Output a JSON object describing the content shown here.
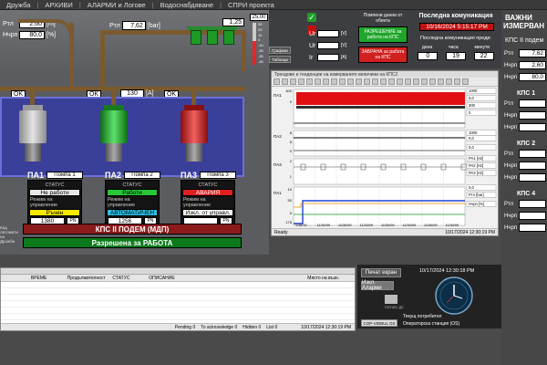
{
  "menu": [
    "Дружба",
    "АРХИВИ",
    "АЛАРМИ и Логове",
    "Водоснабдяване",
    "СПРИ проекта"
  ],
  "process": {
    "top_left": {
      "rtl_label": "Ртл",
      "rtl_value": "2,60",
      "rtl_unit": "[m]",
      "nchr_label": "Нчрп",
      "nchr_value": "80,0",
      "nchr_unit": "[%]"
    },
    "pressure": {
      "label": "Ртл",
      "value": "7,62",
      "unit": "[bar]"
    },
    "tank_value": "1,25",
    "thermo": {
      "value": "25,00",
      "ticks": [
        "30",
        "20",
        "10",
        "0",
        "-10",
        "-20",
        "-30",
        "-40"
      ]
    },
    "buttons": [
      "Графики",
      "Таблици"
    ],
    "ok_labels": [
      "OK",
      "OK",
      "OK"
    ],
    "flow_value": "130",
    "flow_unit": "[A]",
    "pumps": [
      {
        "id": "ПА1",
        "name": "Помпа 1",
        "status_lbl": "СТАТУС",
        "status": "Не работи",
        "mode_lbl": "Режим на управление",
        "mode": "Ръчен",
        "freq": "1380",
        "freq_unit": "PN",
        "color": "#cfcfcf"
      },
      {
        "id": "ПА2",
        "name": "Помпа 2",
        "status_lbl": "СТАТУС",
        "status": "Работи",
        "mode_lbl": "Режим на управление",
        "mode": "АВТОМАТИЧЕН",
        "freq": "1256",
        "freq_unit": "PN",
        "color": "#1fae2a"
      },
      {
        "id": "ПА3",
        "name": "Помпа 3",
        "status_lbl": "СТАТУС",
        "status": "АВАРИЯ",
        "mode_lbl": "Режим на управление",
        "mode": "Изкл. от управл.",
        "freq": "",
        "freq_unit": "PN",
        "color": "#d11c1c"
      }
    ],
    "banner1": "КПС II ПОДЕМ (МДП)",
    "banner2": "Разрешена за РАБОТА",
    "side_note": [
      "Кад",
      "Автомати",
      "на",
      "Дрожби"
    ]
  },
  "controls": {
    "ur_label": "Ur",
    "ur_unit": "[V]",
    "ir_label": "Ir",
    "ir_unit": "[A]",
    "live_data_title": "Помпени данни от обекта",
    "perm_btn": "РАЗРЕШЕНИЕ за работа на КПС",
    "ban_btn": "ЗАБРАНА за работа на КПС"
  },
  "comm": {
    "title": "Последна комуникация",
    "last": "10/16/2024 5:15:17 PM",
    "since_title": "Последна комуникация преди:",
    "days_lbl": "дена",
    "hours_lbl": "часа",
    "min_lbl": "минути",
    "days": "0",
    "hours": "19",
    "minutes": "22"
  },
  "right_panel": {
    "title1": "ВАЖНИ",
    "title2": "ИЗМЕРВАН",
    "sub": "КПС II подем",
    "rows_top": [
      {
        "lbl": "Ртл",
        "val": "7,62"
      },
      {
        "lbl": "Нчрп",
        "val": "2,60"
      },
      {
        "lbl": "Нчрп",
        "val": "80,0"
      }
    ],
    "groups": [
      {
        "title": "КПС 1",
        "rows": [
          "Ртл",
          "Нчрп",
          "Нчрп"
        ]
      },
      {
        "title": "КПС 2",
        "rows": [
          "Ртл",
          "Нчрп",
          "Нчрп"
        ]
      },
      {
        "title": "КПС 4",
        "rows": [
          "Ртл",
          "Нчрп",
          "Нчрп"
        ]
      }
    ]
  },
  "trend": {
    "title": "Трендове и тенденции на измерваните величини на КПС2",
    "y_left": [
      "400",
      "0",
      "8",
      "5",
      "0",
      "2",
      "1",
      "10",
      "50",
      "0",
      "175"
    ],
    "lanes": [
      "ПА1",
      "ПА2",
      "ПА3",
      "ПА1"
    ],
    "chips": [
      "1000",
      "0,0",
      "300",
      "0",
      "1000",
      "0,0",
      "0,0",
      "РА1 [Hz]",
      "РА2 [Hz]",
      "РА3 [Hz]",
      "0,0",
      "Ртл [bar]",
      "Нчрп [%]"
    ],
    "x_ticks": [
      "1:48:00\n7:16:24",
      "11/30/09\n17:16:24",
      "11/30/09\n17:16:24",
      "11/30/09\n17:16:24",
      "11/30/09\n17:16:24",
      "11/30/09\n17:16:24",
      "11/30/09\n17:16:24",
      "11/30/09\n17:16:24"
    ],
    "status": "Ready",
    "status_date": "10/17/2024   12:30:19 PM",
    "colors": {
      "red": "#e01010",
      "dark": "#303030",
      "blue": "#2040d0",
      "green": "#109020",
      "orange": "#e08a00"
    }
  },
  "alarm": {
    "headers": [
      "ВРЕМЕ",
      "Продължителност",
      "СТАТУС",
      "ОПИСАНИЕ",
      "Място на възн."
    ],
    "footer": [
      "Pending 0",
      "To acknowledge 0",
      "Hidden 0",
      "List 0"
    ],
    "foot_date": "10/17/2024   12:30:19 PM"
  },
  "bottom_right": {
    "print_btn": "Печат екран",
    "alarm_btn": "Изкл. Аларми",
    "clock": "10/17/2024 12:30:18 PM",
    "user_lbl": "Текущ потребител",
    "user": "",
    "station_btn": "COP-VIDBUL OS",
    "station_lbl": "Операторска станция (OS)",
    "small": "ПОЛИС ДС"
  }
}
